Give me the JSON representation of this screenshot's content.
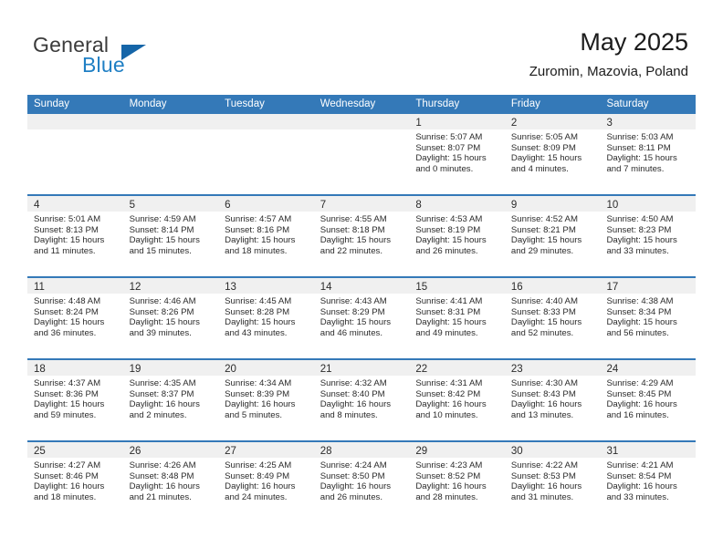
{
  "brand": {
    "word1": "General",
    "word2": "Blue",
    "accent_color": "#1f7fc4",
    "triangle_color": "#1565a8"
  },
  "header": {
    "title": "May 2025",
    "subtitle": "Zuromin, Mazovia, Poland"
  },
  "theme": {
    "header_blue": "#3479b8",
    "daynum_band": "#f0f0f0",
    "text": "#2b2b2b"
  },
  "weekdays": [
    "Sunday",
    "Monday",
    "Tuesday",
    "Wednesday",
    "Thursday",
    "Friday",
    "Saturday"
  ],
  "weeks": [
    [
      {
        "day": ""
      },
      {
        "day": ""
      },
      {
        "day": ""
      },
      {
        "day": ""
      },
      {
        "day": "1",
        "sunrise": "Sunrise: 5:07 AM",
        "sunset": "Sunset: 8:07 PM",
        "daylight1": "Daylight: 15 hours",
        "daylight2": "and 0 minutes."
      },
      {
        "day": "2",
        "sunrise": "Sunrise: 5:05 AM",
        "sunset": "Sunset: 8:09 PM",
        "daylight1": "Daylight: 15 hours",
        "daylight2": "and 4 minutes."
      },
      {
        "day": "3",
        "sunrise": "Sunrise: 5:03 AM",
        "sunset": "Sunset: 8:11 PM",
        "daylight1": "Daylight: 15 hours",
        "daylight2": "and 7 minutes."
      }
    ],
    [
      {
        "day": "4",
        "sunrise": "Sunrise: 5:01 AM",
        "sunset": "Sunset: 8:13 PM",
        "daylight1": "Daylight: 15 hours",
        "daylight2": "and 11 minutes."
      },
      {
        "day": "5",
        "sunrise": "Sunrise: 4:59 AM",
        "sunset": "Sunset: 8:14 PM",
        "daylight1": "Daylight: 15 hours",
        "daylight2": "and 15 minutes."
      },
      {
        "day": "6",
        "sunrise": "Sunrise: 4:57 AM",
        "sunset": "Sunset: 8:16 PM",
        "daylight1": "Daylight: 15 hours",
        "daylight2": "and 18 minutes."
      },
      {
        "day": "7",
        "sunrise": "Sunrise: 4:55 AM",
        "sunset": "Sunset: 8:18 PM",
        "daylight1": "Daylight: 15 hours",
        "daylight2": "and 22 minutes."
      },
      {
        "day": "8",
        "sunrise": "Sunrise: 4:53 AM",
        "sunset": "Sunset: 8:19 PM",
        "daylight1": "Daylight: 15 hours",
        "daylight2": "and 26 minutes."
      },
      {
        "day": "9",
        "sunrise": "Sunrise: 4:52 AM",
        "sunset": "Sunset: 8:21 PM",
        "daylight1": "Daylight: 15 hours",
        "daylight2": "and 29 minutes."
      },
      {
        "day": "10",
        "sunrise": "Sunrise: 4:50 AM",
        "sunset": "Sunset: 8:23 PM",
        "daylight1": "Daylight: 15 hours",
        "daylight2": "and 33 minutes."
      }
    ],
    [
      {
        "day": "11",
        "sunrise": "Sunrise: 4:48 AM",
        "sunset": "Sunset: 8:24 PM",
        "daylight1": "Daylight: 15 hours",
        "daylight2": "and 36 minutes."
      },
      {
        "day": "12",
        "sunrise": "Sunrise: 4:46 AM",
        "sunset": "Sunset: 8:26 PM",
        "daylight1": "Daylight: 15 hours",
        "daylight2": "and 39 minutes."
      },
      {
        "day": "13",
        "sunrise": "Sunrise: 4:45 AM",
        "sunset": "Sunset: 8:28 PM",
        "daylight1": "Daylight: 15 hours",
        "daylight2": "and 43 minutes."
      },
      {
        "day": "14",
        "sunrise": "Sunrise: 4:43 AM",
        "sunset": "Sunset: 8:29 PM",
        "daylight1": "Daylight: 15 hours",
        "daylight2": "and 46 minutes."
      },
      {
        "day": "15",
        "sunrise": "Sunrise: 4:41 AM",
        "sunset": "Sunset: 8:31 PM",
        "daylight1": "Daylight: 15 hours",
        "daylight2": "and 49 minutes."
      },
      {
        "day": "16",
        "sunrise": "Sunrise: 4:40 AM",
        "sunset": "Sunset: 8:33 PM",
        "daylight1": "Daylight: 15 hours",
        "daylight2": "and 52 minutes."
      },
      {
        "day": "17",
        "sunrise": "Sunrise: 4:38 AM",
        "sunset": "Sunset: 8:34 PM",
        "daylight1": "Daylight: 15 hours",
        "daylight2": "and 56 minutes."
      }
    ],
    [
      {
        "day": "18",
        "sunrise": "Sunrise: 4:37 AM",
        "sunset": "Sunset: 8:36 PM",
        "daylight1": "Daylight: 15 hours",
        "daylight2": "and 59 minutes."
      },
      {
        "day": "19",
        "sunrise": "Sunrise: 4:35 AM",
        "sunset": "Sunset: 8:37 PM",
        "daylight1": "Daylight: 16 hours",
        "daylight2": "and 2 minutes."
      },
      {
        "day": "20",
        "sunrise": "Sunrise: 4:34 AM",
        "sunset": "Sunset: 8:39 PM",
        "daylight1": "Daylight: 16 hours",
        "daylight2": "and 5 minutes."
      },
      {
        "day": "21",
        "sunrise": "Sunrise: 4:32 AM",
        "sunset": "Sunset: 8:40 PM",
        "daylight1": "Daylight: 16 hours",
        "daylight2": "and 8 minutes."
      },
      {
        "day": "22",
        "sunrise": "Sunrise: 4:31 AM",
        "sunset": "Sunset: 8:42 PM",
        "daylight1": "Daylight: 16 hours",
        "daylight2": "and 10 minutes."
      },
      {
        "day": "23",
        "sunrise": "Sunrise: 4:30 AM",
        "sunset": "Sunset: 8:43 PM",
        "daylight1": "Daylight: 16 hours",
        "daylight2": "and 13 minutes."
      },
      {
        "day": "24",
        "sunrise": "Sunrise: 4:29 AM",
        "sunset": "Sunset: 8:45 PM",
        "daylight1": "Daylight: 16 hours",
        "daylight2": "and 16 minutes."
      }
    ],
    [
      {
        "day": "25",
        "sunrise": "Sunrise: 4:27 AM",
        "sunset": "Sunset: 8:46 PM",
        "daylight1": "Daylight: 16 hours",
        "daylight2": "and 18 minutes."
      },
      {
        "day": "26",
        "sunrise": "Sunrise: 4:26 AM",
        "sunset": "Sunset: 8:48 PM",
        "daylight1": "Daylight: 16 hours",
        "daylight2": "and 21 minutes."
      },
      {
        "day": "27",
        "sunrise": "Sunrise: 4:25 AM",
        "sunset": "Sunset: 8:49 PM",
        "daylight1": "Daylight: 16 hours",
        "daylight2": "and 24 minutes."
      },
      {
        "day": "28",
        "sunrise": "Sunrise: 4:24 AM",
        "sunset": "Sunset: 8:50 PM",
        "daylight1": "Daylight: 16 hours",
        "daylight2": "and 26 minutes."
      },
      {
        "day": "29",
        "sunrise": "Sunrise: 4:23 AM",
        "sunset": "Sunset: 8:52 PM",
        "daylight1": "Daylight: 16 hours",
        "daylight2": "and 28 minutes."
      },
      {
        "day": "30",
        "sunrise": "Sunrise: 4:22 AM",
        "sunset": "Sunset: 8:53 PM",
        "daylight1": "Daylight: 16 hours",
        "daylight2": "and 31 minutes."
      },
      {
        "day": "31",
        "sunrise": "Sunrise: 4:21 AM",
        "sunset": "Sunset: 8:54 PM",
        "daylight1": "Daylight: 16 hours",
        "daylight2": "and 33 minutes."
      }
    ]
  ]
}
